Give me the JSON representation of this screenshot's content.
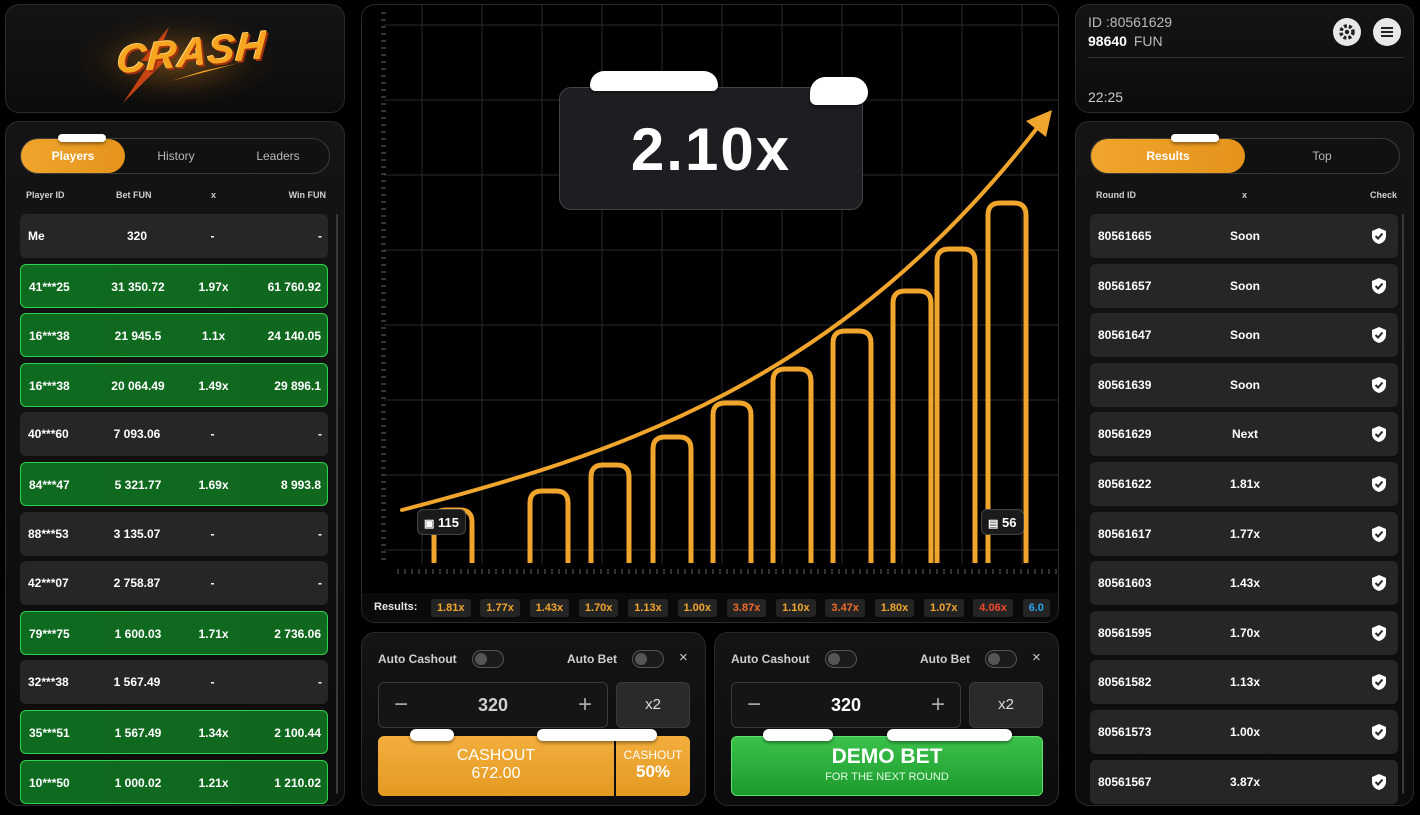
{
  "logo": {
    "text": "CRASH"
  },
  "players_panel": {
    "tabs": [
      {
        "label": "Players"
      },
      {
        "label": "History"
      },
      {
        "label": "Leaders"
      }
    ],
    "headers": {
      "player": "Player ID",
      "bet": "Bet  FUN",
      "x": "x",
      "win": "Win  FUN"
    },
    "rows": [
      {
        "id": "Me",
        "bet": "320",
        "x": "-",
        "win": "-",
        "won": false
      },
      {
        "id": "41***25",
        "bet": "31 350.72",
        "x": "1.97x",
        "win": "61 760.92",
        "won": true
      },
      {
        "id": "16***38",
        "bet": "21 945.5",
        "x": "1.1x",
        "win": "24 140.05",
        "won": true
      },
      {
        "id": "16***38",
        "bet": "20 064.49",
        "x": "1.49x",
        "win": "29 896.1",
        "won": true
      },
      {
        "id": "40***60",
        "bet": "7 093.06",
        "x": "-",
        "win": "-",
        "won": false
      },
      {
        "id": "84***47",
        "bet": "5 321.77",
        "x": "1.69x",
        "win": "8 993.8",
        "won": true
      },
      {
        "id": "88***53",
        "bet": "3 135.07",
        "x": "-",
        "win": "-",
        "won": false
      },
      {
        "id": "42***07",
        "bet": "2 758.87",
        "x": "-",
        "win": "-",
        "won": false
      },
      {
        "id": "79***75",
        "bet": "1 600.03",
        "x": "1.71x",
        "win": "2 736.06",
        "won": true
      },
      {
        "id": "32***38",
        "bet": "1 567.49",
        "x": "-",
        "win": "-",
        "won": false
      },
      {
        "id": "35***51",
        "bet": "1 567.49",
        "x": "1.34x",
        "win": "2 100.44",
        "won": true
      },
      {
        "id": "10***50",
        "bet": "1 000.02",
        "x": "1.21x",
        "win": "1 210.02",
        "won": true
      }
    ]
  },
  "game": {
    "multiplier": "2.10x",
    "bettors_count": "115",
    "cashed_count": "56",
    "results_label": "Results:",
    "recent_results": [
      {
        "value": "1.81x",
        "color": "#f0a52c"
      },
      {
        "value": "1.77x",
        "color": "#f0a52c"
      },
      {
        "value": "1.43x",
        "color": "#f0a52c"
      },
      {
        "value": "1.70x",
        "color": "#f0a52c"
      },
      {
        "value": "1.13x",
        "color": "#f0a52c"
      },
      {
        "value": "1.00x",
        "color": "#f0a52c"
      },
      {
        "value": "3.87x",
        "color": "#f06a2c"
      },
      {
        "value": "1.10x",
        "color": "#f0a52c"
      },
      {
        "value": "3.47x",
        "color": "#f06a2c"
      },
      {
        "value": "1.80x",
        "color": "#f0a52c"
      },
      {
        "value": "1.07x",
        "color": "#f0a52c"
      },
      {
        "value": "4.06x",
        "color": "#f04a2c"
      },
      {
        "value": "6.0",
        "color": "#2ca5f0"
      }
    ],
    "accent_color": "#f0a52c"
  },
  "bet_panel_1": {
    "auto_cashout": "Auto Cashout",
    "auto_bet": "Auto Bet",
    "amount": "320",
    "minus": "−",
    "plus": "+",
    "double": "x2",
    "close": "×",
    "cashout_label": "CASHOUT",
    "cashout_amount": "672.00",
    "partial_label": "CASHOUT",
    "partial_pct": "50%"
  },
  "bet_panel_2": {
    "auto_cashout": "Auto Cashout",
    "auto_bet": "Auto Bet",
    "amount": "320",
    "minus": "−",
    "plus": "+",
    "double": "x2",
    "close": "×",
    "demo_label": "DEMO BET",
    "demo_sub": "FOR THE NEXT ROUND"
  },
  "account": {
    "id": "ID :80561629",
    "balance": "98640",
    "currency": "FUN",
    "time": "22:25",
    "icons": [
      "gear-icon",
      "menu-icon"
    ]
  },
  "results_panel": {
    "tabs": [
      {
        "label": "Results"
      },
      {
        "label": "Top"
      }
    ],
    "headers": {
      "round": "Round ID",
      "x": "x",
      "check": "Check"
    },
    "rows": [
      {
        "round": "80561665",
        "x": "Soon"
      },
      {
        "round": "80561657",
        "x": "Soon"
      },
      {
        "round": "80561647",
        "x": "Soon"
      },
      {
        "round": "80561639",
        "x": "Soon"
      },
      {
        "round": "80561629",
        "x": "Next"
      },
      {
        "round": "80561622",
        "x": "1.81x"
      },
      {
        "round": "80561617",
        "x": "1.77x"
      },
      {
        "round": "80561603",
        "x": "1.43x"
      },
      {
        "round": "80561595",
        "x": "1.70x"
      },
      {
        "round": "80561582",
        "x": "1.13x"
      },
      {
        "round": "80561573",
        "x": "1.00x"
      },
      {
        "round": "80561567",
        "x": "3.87x"
      }
    ]
  }
}
